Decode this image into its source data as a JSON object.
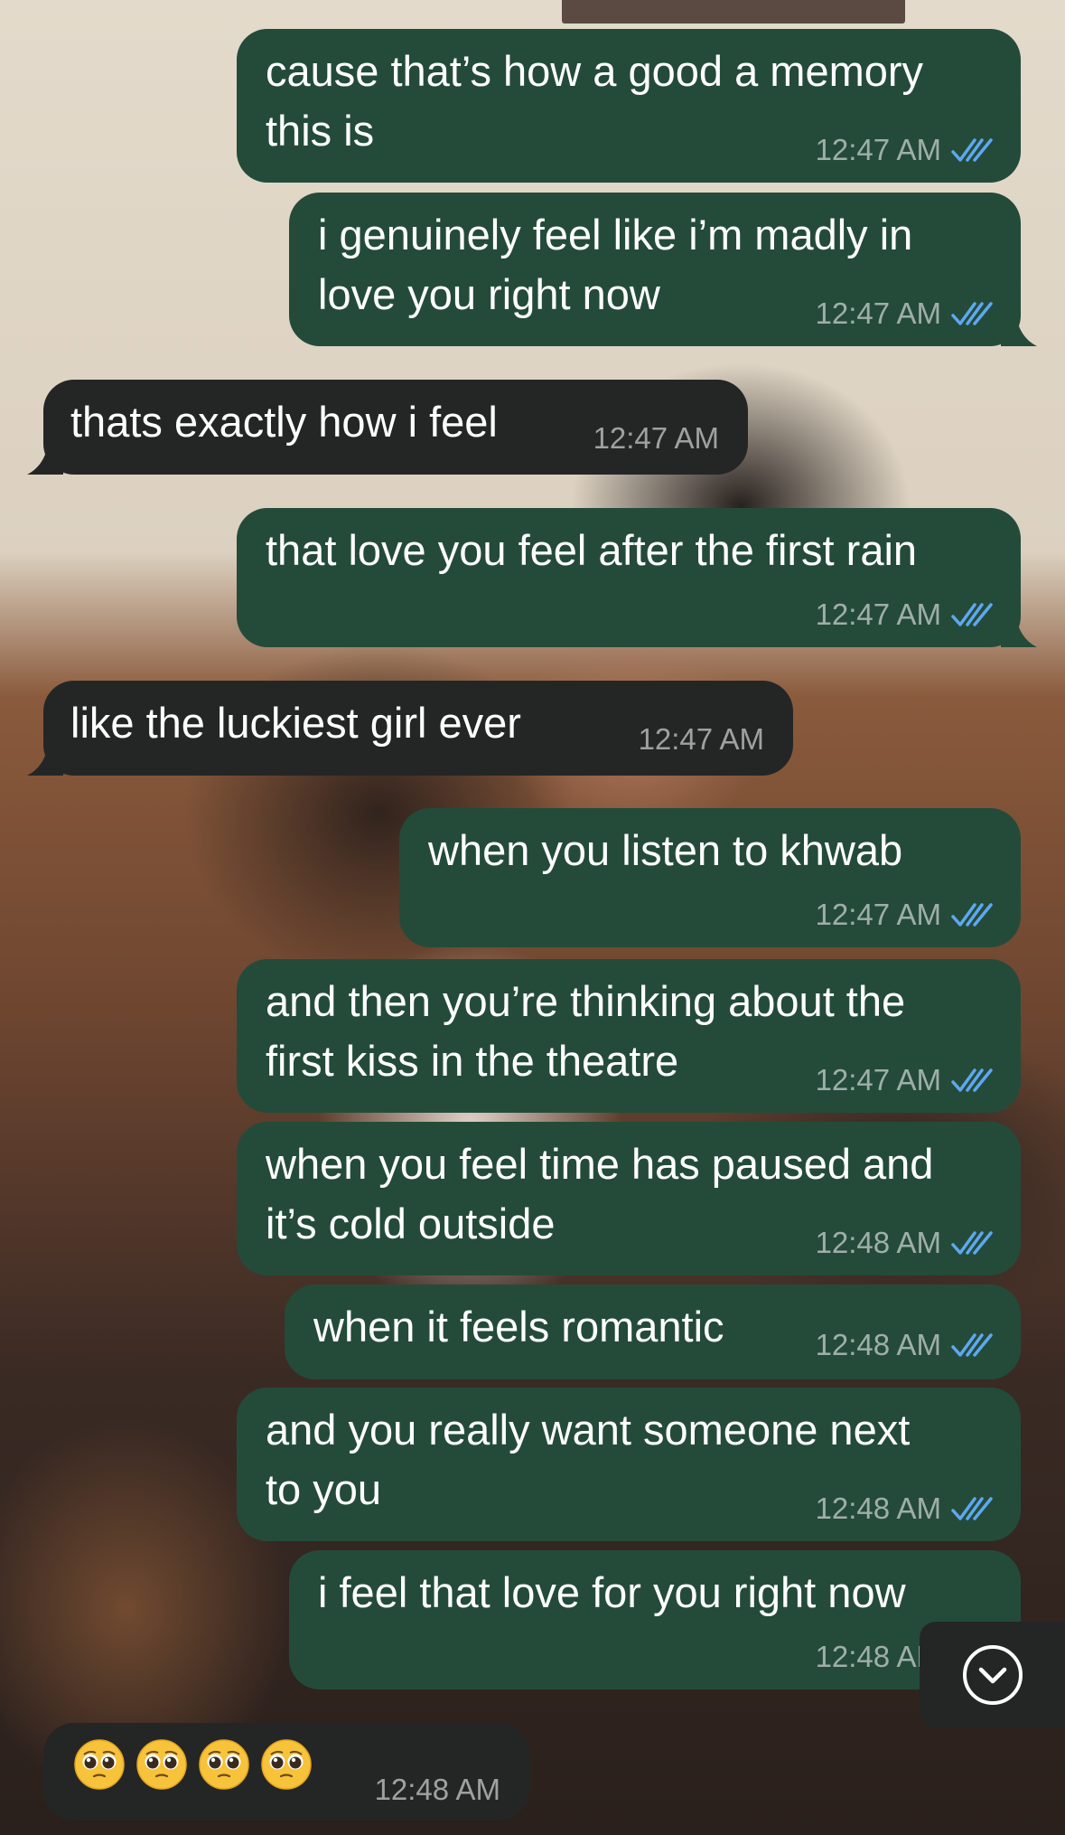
{
  "chat": {
    "messages": [
      {
        "direction": "outgoing",
        "text": "cause that’s how a good a memory\nthis is",
        "time": "12:47 AM",
        "read": true
      },
      {
        "direction": "outgoing",
        "text": "i genuinely feel like i’m madly in\nlove you right now",
        "time": "12:47 AM",
        "read": true
      },
      {
        "direction": "incoming",
        "text": "thats exactly how i feel",
        "time": "12:47 AM"
      },
      {
        "direction": "outgoing",
        "text": "that love you feel after the first rain",
        "time": "12:47 AM",
        "read": true
      },
      {
        "direction": "incoming",
        "text": "like the luckiest girl ever",
        "time": "12:47 AM"
      },
      {
        "direction": "outgoing",
        "text": "when you listen to khwab",
        "time": "12:47 AM",
        "read": true
      },
      {
        "direction": "outgoing",
        "text": "and then you’re thinking about the\nfirst kiss in the theatre",
        "time": "12:47 AM",
        "read": true
      },
      {
        "direction": "outgoing",
        "text": "when you feel time has paused and\nit’s cold outside",
        "time": "12:48 AM",
        "read": true
      },
      {
        "direction": "outgoing",
        "text": "when it feels romantic",
        "time": "12:48 AM",
        "read": true
      },
      {
        "direction": "outgoing",
        "text": "and you really want someone next\nto you",
        "time": "12:48 AM",
        "read": true
      },
      {
        "direction": "outgoing",
        "text": "i feel that love for you right now",
        "time": "12:48 AM",
        "read": true
      },
      {
        "direction": "incoming",
        "emoji": [
          "pleading-face",
          "pleading-face",
          "pleading-face",
          "pleading-face"
        ],
        "time": "12:48 AM"
      }
    ]
  },
  "colors": {
    "outgoing_bubble": "#244b3a",
    "incoming_bubble": "#242626",
    "read_ticks": "#5ea8f0"
  },
  "icons": {
    "scroll_down": "chevron-down-circle-icon",
    "read_receipt": "double-check-icon"
  }
}
